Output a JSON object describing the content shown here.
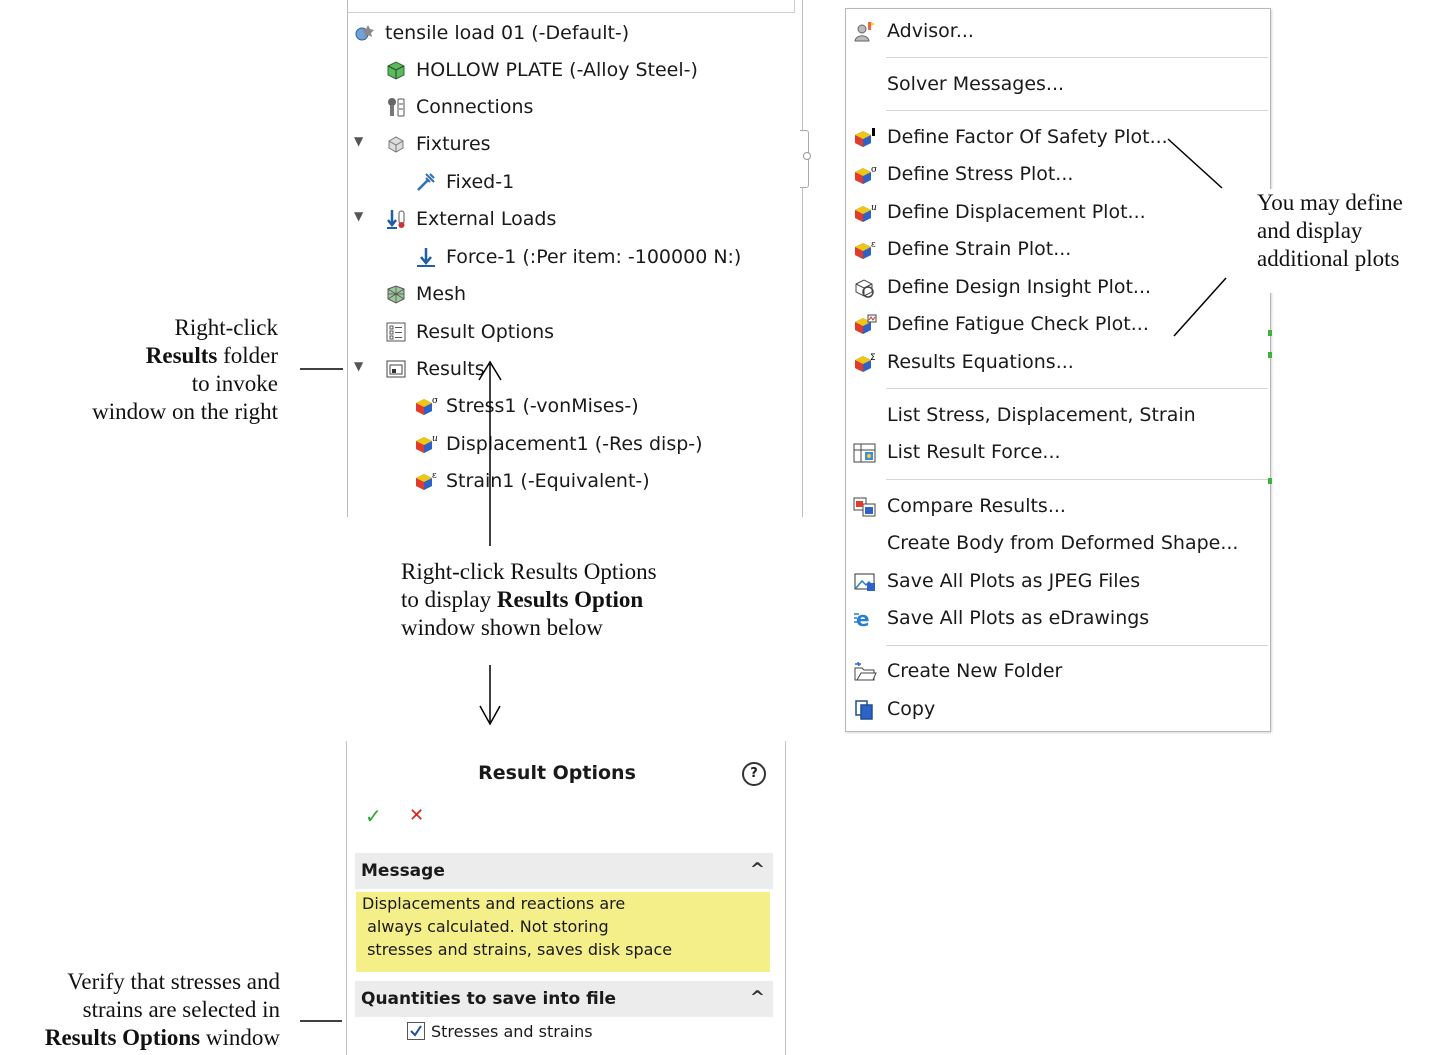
{
  "tree": {
    "study": "tensile load 01 (-Default-)",
    "part": "HOLLOW PLATE (-Alloy Steel-)",
    "connections": "Connections",
    "fixtures": "Fixtures",
    "fixed": "Fixed-1",
    "external_loads": "External Loads",
    "force": "Force-1 (:Per item: -100000 N:)",
    "mesh": "Mesh",
    "result_options": "Result Options",
    "results": "Results",
    "plots": [
      {
        "label": "Stress1 (-vonMises-)",
        "badge": "σ"
      },
      {
        "label": "Displacement1 (-Res disp-)",
        "badge": "u"
      },
      {
        "label": "Strain1 (-Equivalent-)",
        "badge": "ε"
      }
    ]
  },
  "menu": {
    "advisor": "Advisor...",
    "solver_messages": "Solver Messages...",
    "factor_of_safety": "Define Factor Of Safety Plot...",
    "stress": "Define Stress Plot...",
    "displacement": "Define Displacement Plot...",
    "strain": "Define Strain Plot...",
    "design_insight": "Define Design Insight Plot...",
    "fatigue": "Define Fatigue Check Plot...",
    "equations": "Results Equations...",
    "list_stress": "List Stress, Displacement, Strain",
    "list_force": "List Result Force...",
    "compare": "Compare Results...",
    "create_body": "Create Body from Deformed Shape...",
    "save_jpeg": "Save All Plots as JPEG Files",
    "save_edrawings": "Save All Plots as eDrawings",
    "new_folder": "Create New Folder",
    "copy": "Copy"
  },
  "result_options": {
    "title": "Result Options",
    "help": "?",
    "ok": "✓",
    "cancel": "✕",
    "message_header": "Message",
    "message_lines": [
      "Displacements and reactions are",
      " always calculated. Not storing",
      " stresses and strains, saves disk space"
    ],
    "quantities_header": "Quantities to save into file",
    "checkbox_label": "Stresses and strains",
    "checkbox_checked": true,
    "collapse": "^"
  },
  "annotations": {
    "left_top": [
      "Right-click",
      "Results",
      " folder",
      "to invoke",
      "window on the right"
    ],
    "middle": [
      "Right-click Results Options",
      "to display ",
      "Results Option",
      "window shown below"
    ],
    "right": [
      "You may define",
      "and display",
      "additional plots"
    ],
    "left_bottom": [
      "Verify that stresses and",
      "strains are selected in",
      "Results Options",
      " window"
    ]
  }
}
